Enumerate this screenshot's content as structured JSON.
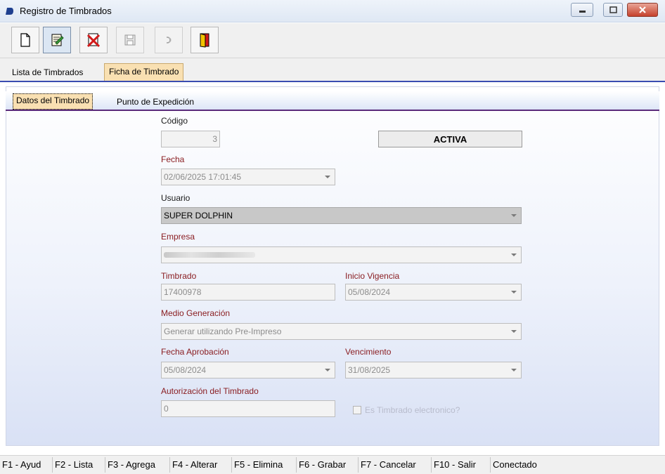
{
  "window": {
    "title": "Registro de Timbrados"
  },
  "toolbar": {
    "buttons": [
      {
        "name": "new-document-icon",
        "state": "normal"
      },
      {
        "name": "edit-list-icon",
        "state": "pressed"
      },
      {
        "name": "delete-icon",
        "state": "normal"
      },
      {
        "name": "save-icon",
        "state": "disabled"
      },
      {
        "name": "undo-icon",
        "state": "disabled"
      },
      {
        "name": "exit-door-icon",
        "state": "normal"
      }
    ]
  },
  "tabs": [
    {
      "label": "Lista de Timbrados",
      "active": false
    },
    {
      "label": "Ficha de Timbrado",
      "active": true
    }
  ],
  "subtabs": [
    {
      "label": "Datos del Timbrado",
      "active": true
    },
    {
      "label": "Punto de Expedición",
      "active": false
    }
  ],
  "form": {
    "codigo": {
      "label": "Código",
      "value": "3"
    },
    "estado": "ACTIVA",
    "fecha": {
      "label": "Fecha",
      "value": "02/06/2025 17:01:45"
    },
    "usuario": {
      "label": "Usuario",
      "value": "SUPER DOLPHIN"
    },
    "empresa": {
      "label": "Empresa",
      "value": ""
    },
    "timbrado": {
      "label": "Timbrado",
      "value": "17400978"
    },
    "inicio_vigencia": {
      "label": "Inicio Vigencia",
      "value": "05/08/2024"
    },
    "medio_generacion": {
      "label": "Medio Generación",
      "value": "Generar utilizando Pre-Impreso"
    },
    "fecha_aprobacion": {
      "label": "Fecha Aprobación",
      "value": "05/08/2024"
    },
    "vencimiento": {
      "label": "Vencimiento",
      "value": "31/08/2025"
    },
    "autorizacion": {
      "label": "Autorización del Timbrado",
      "value": "0"
    },
    "es_electronico": {
      "label": "Es Timbrado electronico?",
      "checked": false
    }
  },
  "statusbar": {
    "items": [
      "F1 - Ayud",
      "F2 - Lista",
      "F3 - Agrega",
      "F4 - Alterar",
      "F5 - Elimina",
      "F6 - Grabar",
      "F7 - Cancelar",
      "F10 - Salir",
      "Conectado"
    ]
  },
  "colors": {
    "accent_tab": "#f9e0b2",
    "label_red": "#8a1e22",
    "tab_line": "#3a4cb0"
  }
}
